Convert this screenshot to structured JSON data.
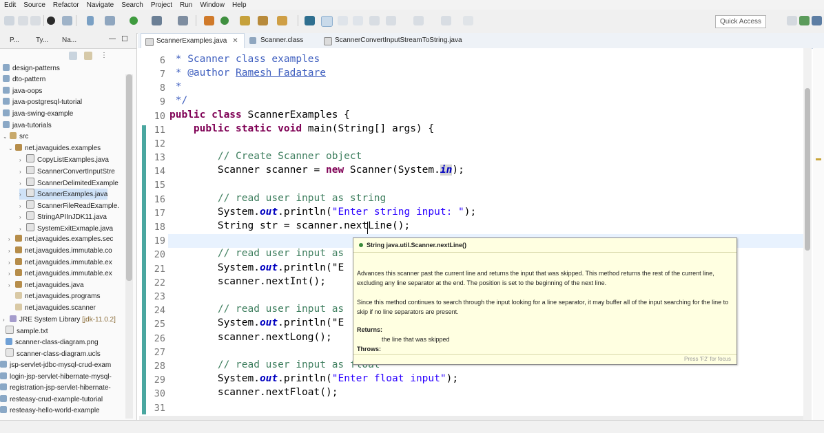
{
  "menu": [
    "Edit",
    "Source",
    "Refactor",
    "Navigate",
    "Search",
    "Project",
    "Run",
    "Window",
    "Help"
  ],
  "toolbar": {
    "quick_access": "Quick Access"
  },
  "package_explorer": {
    "tabs": [
      "P...",
      "Ty...",
      "Na..."
    ],
    "items": [
      {
        "label": "design-patterns",
        "type": "project"
      },
      {
        "label": "dto-pattern",
        "type": "project"
      },
      {
        "label": "java-oops",
        "type": "project"
      },
      {
        "label": "java-postgresql-tutorial",
        "type": "project"
      },
      {
        "label": "java-swing-example",
        "type": "project"
      },
      {
        "label": "java-tutorials",
        "type": "project"
      },
      {
        "label": "src",
        "type": "folder"
      },
      {
        "label": "net.javaguides.examples",
        "type": "package"
      },
      {
        "label": "CopyListExamples.java",
        "type": "file"
      },
      {
        "label": "ScannerConvertInputStre",
        "type": "file"
      },
      {
        "label": "ScannerDelimitedExample",
        "type": "file"
      },
      {
        "label": "ScannerExamples.java",
        "type": "file"
      },
      {
        "label": "ScannerFileReadExample.",
        "type": "file"
      },
      {
        "label": "StringAPIInJDK11.java",
        "type": "file"
      },
      {
        "label": "SystemExitExmaple.java",
        "type": "file"
      },
      {
        "label": "net.javaguides.examples.sec",
        "type": "package"
      },
      {
        "label": "net.javaguides.immutable.co",
        "type": "package"
      },
      {
        "label": "net.javaguides.immutable.ex",
        "type": "package"
      },
      {
        "label": "net.javaguides.immutable.ex",
        "type": "package"
      },
      {
        "label": "net.javaguides.java",
        "type": "package"
      },
      {
        "label": "net.javaguides.programs",
        "type": "package"
      },
      {
        "label": "net.javaguides.scanner",
        "type": "package"
      },
      {
        "label": "JRE System Library",
        "suffix": "[jdk-11.0.2]",
        "type": "library"
      },
      {
        "label": "sample.txt",
        "type": "text"
      },
      {
        "label": "scanner-class-diagram.png",
        "type": "image"
      },
      {
        "label": "scanner-class-diagram.ucls",
        "type": "text"
      },
      {
        "label": "jsp-servlet-jdbc-mysql-crud-exam",
        "type": "project"
      },
      {
        "label": "login-jsp-servlet-hibernate-mysql-",
        "type": "project"
      },
      {
        "label": "registration-jsp-servlet-hibernate-",
        "type": "project"
      },
      {
        "label": "resteasy-crud-example-tutorial",
        "type": "project"
      },
      {
        "label": "resteasy-hello-world-example",
        "type": "project"
      }
    ]
  },
  "editor_tabs": [
    {
      "label": "ScannerExamples.java",
      "active": true
    },
    {
      "label": "Scanner.class",
      "active": false
    },
    {
      "label": "ScannerConvertInputStreamToString.java",
      "active": false
    }
  ],
  "code": {
    "line_numbers": [
      "6",
      "7",
      "8",
      "9",
      "10",
      "11",
      "12",
      "13",
      "14",
      "15",
      "16",
      "17",
      "18",
      "19",
      "20",
      "21",
      "22",
      "23",
      "24",
      "25",
      "26",
      "27",
      "28",
      "29",
      "30",
      "31"
    ],
    "l6": " * Scanner class examples",
    "l7a": " * @author ",
    "l7b": "Ramesh Fadatare",
    "l8": " *",
    "l9": " */",
    "l10a": "public class ",
    "l10b": "ScannerExamples {",
    "l11a": "    public static void ",
    "l11b": "main(String[] args) {",
    "l13": "        // Create Scanner object",
    "l14a": "        Scanner scanner = ",
    "l14b": "new",
    "l14c": " Scanner(System.",
    "l14d": "in",
    "l14e": ");",
    "l16": "        // read user input as string",
    "l17a": "        System.",
    "l17b": "out",
    "l17c": ".println(",
    "l17d": "\"Enter string input: \"",
    "l17e": ");",
    "l18": "        String str = scanner.nextLine();",
    "l20": "        // read user input as",
    "l21a": "        System.",
    "l21b": "out",
    "l21c": ".println(\"E",
    "l22": "        scanner.nextInt();",
    "l24": "        // read user input as",
    "l25a": "        System.",
    "l25b": "out",
    "l25c": ".println(\"E",
    "l26": "        scanner.nextLong();",
    "l28": "        // read user input as float",
    "l29a": "        System.",
    "l29b": "out",
    "l29c": ".println(",
    "l29d": "\"Enter float input\"",
    "l29e": ");",
    "l30": "        scanner.nextFloat();"
  },
  "javadoc": {
    "signature": "String java.util.Scanner.nextLine()",
    "para1": "Advances this scanner past the current line and returns the input that was skipped. This method returns the rest of the current line, excluding any line separator at the end. The position is set to the beginning of the next line.",
    "para2": "Since this method continues to search through the input looking for a line separator, it may buffer all of the input searching for the line to skip if no line separators are present.",
    "returns_label": "Returns:",
    "returns_text": "the line that was skipped",
    "throws_label": "Throws:",
    "footer": "Press 'F2' for focus"
  },
  "colors": {
    "keyword": "#7f0055",
    "comment": "#3f7f5f",
    "javadoc": "#3f5fbf",
    "string": "#2a00ff",
    "field": "#0000c0",
    "popup_bg": "#ffffe1"
  }
}
